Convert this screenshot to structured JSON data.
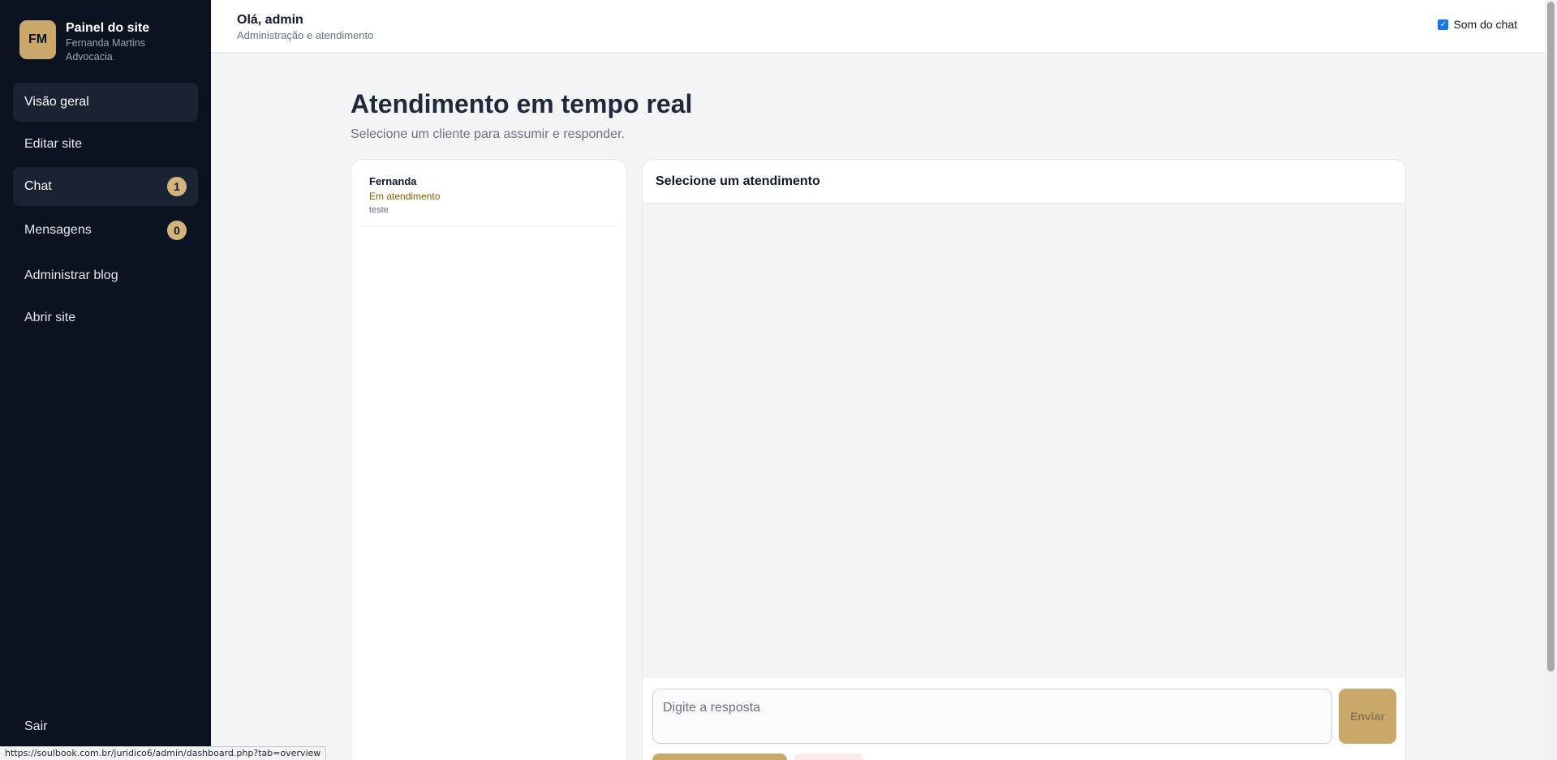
{
  "sidebar": {
    "avatar_initials": "FM",
    "title": "Painel do site",
    "subtitle": "Fernanda Martins Advocacia",
    "items": [
      {
        "label": "Visão geral",
        "active": true
      },
      {
        "label": "Editar site"
      },
      {
        "label": "Chat",
        "badge": "1",
        "active": true
      },
      {
        "label": "Mensagens",
        "badge": "0"
      },
      {
        "label": "Administrar blog"
      },
      {
        "label": "Abrir site"
      }
    ],
    "logout_label": "Sair"
  },
  "topbar": {
    "greeting": "Olá, admin",
    "subtitle": "Administração e atendimento",
    "sound_label": "Som do chat",
    "sound_checked": true
  },
  "main": {
    "title": "Atendimento em tempo real",
    "subtitle": "Selecione um cliente para assumir e responder."
  },
  "conversations": [
    {
      "name": "Fernanda",
      "status": "Em atendimento",
      "last_message": "teste"
    }
  ],
  "chat": {
    "header": "Selecione um atendimento",
    "reply_placeholder": "Digite a resposta",
    "send_label": "Enviar"
  },
  "status_url": "https://soulbook.com.br/juridico6/admin/dashboard.php?tab=overview",
  "colors": {
    "sidebar_bg": "#0b1220",
    "accent_gold": "#c9a86a",
    "status_amber": "#8a6100"
  }
}
